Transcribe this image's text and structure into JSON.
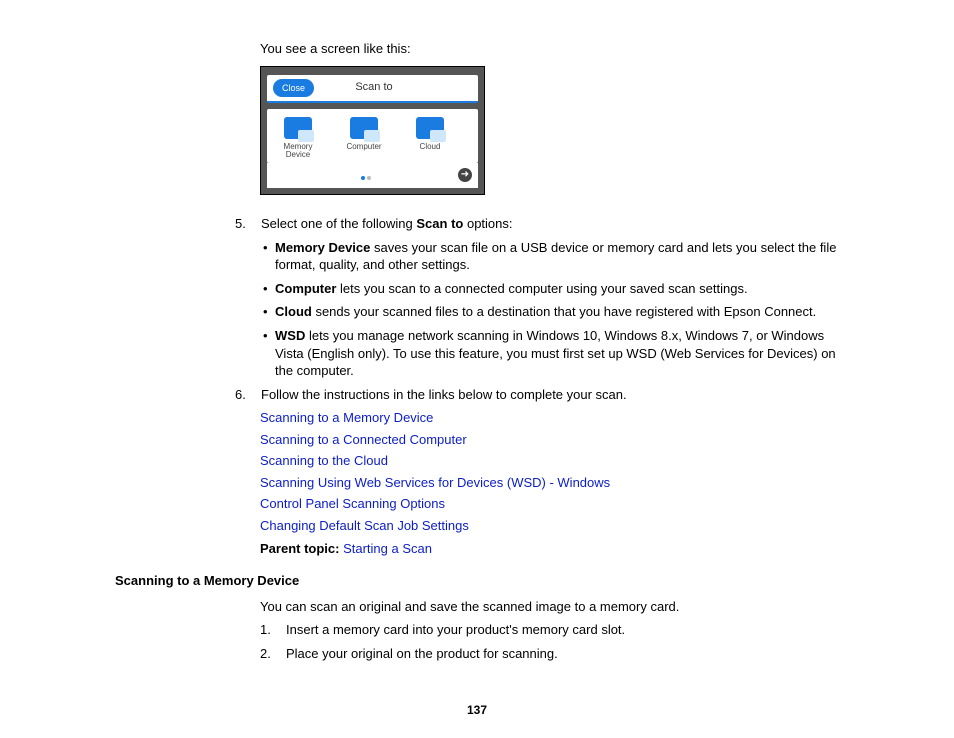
{
  "intro": "You see a screen like this:",
  "screenshot": {
    "close": "Close",
    "title": "Scan to",
    "items": [
      {
        "label": "Memory Device"
      },
      {
        "label": "Computer"
      },
      {
        "label": "Cloud"
      }
    ]
  },
  "step5": {
    "num": "5.",
    "lead_prefix": "Select one of the following ",
    "lead_bold": "Scan to",
    "lead_suffix": " options:",
    "bullets": [
      {
        "bold": "Memory Device",
        "text": " saves your scan file on a USB device or memory card and lets you select the file format, quality, and other settings."
      },
      {
        "bold": "Computer",
        "text": " lets you scan to a connected computer using your saved scan settings."
      },
      {
        "bold": "Cloud",
        "text": " sends your scanned files to a destination that you have registered with Epson Connect."
      },
      {
        "bold": "WSD",
        "text": " lets you manage network scanning in Windows 10, Windows 8.x, Windows 7, or Windows Vista (English only). To use this feature, you must first set up WSD (Web Services for Devices) on the computer."
      }
    ]
  },
  "step6": {
    "num": "6.",
    "text": "Follow the instructions in the links below to complete your scan."
  },
  "links": [
    "Scanning to a Memory Device",
    "Scanning to a Connected Computer",
    "Scanning to the Cloud",
    "Scanning Using Web Services for Devices (WSD) - Windows",
    "Control Panel Scanning Options",
    "Changing Default Scan Job Settings"
  ],
  "parent_label": "Parent topic: ",
  "parent_link": "Starting a Scan",
  "section2": {
    "title": "Scanning to a Memory Device",
    "intro": "You can scan an original and save the scanned image to a memory card.",
    "steps": [
      {
        "num": "1.",
        "text": "Insert a memory card into your product's memory card slot."
      },
      {
        "num": "2.",
        "text": "Place your original on the product for scanning."
      }
    ]
  },
  "page_number": "137"
}
